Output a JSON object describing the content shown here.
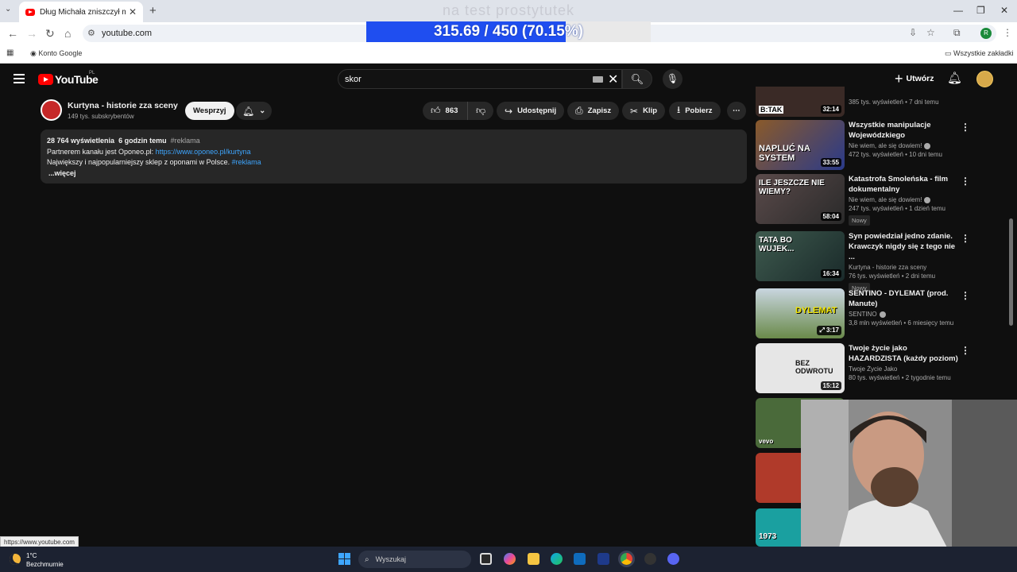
{
  "browser": {
    "tab_title": "Dług Michała zniszczył mu życie",
    "url": "youtube.com",
    "bookmark_left": "Konto Google",
    "bookmark_right": "Wszystkie zakładki",
    "profile_initial": "R",
    "status_link": "https://www.youtube.com"
  },
  "overlay": {
    "title": "na test prostytutek",
    "progress_label": "315.69 / 450 (70.15%)",
    "progress_fraction": 0.7015
  },
  "youtube": {
    "country": "PL",
    "logo_word": "YouTube",
    "search_query": "skor",
    "create_label": "Utwórz"
  },
  "channel": {
    "name": "Kurtyna - historie zza sceny",
    "subs": "149 tys. subskrybentów",
    "support_label": "Wesprzyj",
    "likes": "863",
    "share_label": "Udostępnij",
    "save_label": "Zapisz",
    "clip_label": "Klip",
    "download_label": "Pobierz"
  },
  "description": {
    "views": "28 764 wyświetlenia",
    "time": "6 godzin temu",
    "hashtag": "#reklama",
    "line1_text": "Partnerem kanału jest Oponeo.pl:",
    "line1_link": "https://www.oponeo.pl/kurtyna",
    "line2_text": "Największy i najpopularniejszy sklep z oponami w Polsce.",
    "line2_tag": "#reklama",
    "more": "...więcej"
  },
  "sidebar": {
    "items": [
      {
        "thumb_text": "B:TAK",
        "duration": "32:14",
        "title": "",
        "channel": "",
        "views": "385 tys. wyświetleń",
        "age": "7 dni temu",
        "thumb_color": "#3a2a26"
      },
      {
        "thumb_text": "NAPLUĆ NA SYSTEM",
        "duration": "33:55",
        "title": "Wszystkie manipulacje Wojewódzkiego",
        "channel": "Nie wiem, ale się dowiem!",
        "views": "472 tys. wyświetleń",
        "age": "10 dni temu",
        "thumb_color": "#7a4a2a"
      },
      {
        "thumb_text": "ILE JESZCZE NIE WIEMY?",
        "duration": "58:04",
        "title": "Katastrofa Smoleńska - film dokumentalny",
        "channel": "Nie wiem, ale się dowiem!",
        "views": "247 tys. wyświetleń",
        "age": "1 dzień temu",
        "badge": "Nowy",
        "thumb_color": "#4a3a3a"
      },
      {
        "thumb_text": "TATA BO WUJEK...",
        "duration": "16:34",
        "title": "Syn powiedział jedno zdanie. Krawczyk nigdy się z tego nie ...",
        "channel": "Kurtyna - historie zza sceny",
        "views": "76 tys. wyświetleń",
        "age": "2 dni temu",
        "badge": "Nowy",
        "thumb_color": "#2e4a3e"
      },
      {
        "thumb_text": "DYLEMAT",
        "duration": "3:17",
        "title": "SENTINO - DYLEMAT (prod. Manute)",
        "channel": "SENTINO",
        "views": "3,8 mln wyświetleń",
        "age": "6 miesięcy temu",
        "thumb_color": "#5c7a4a"
      },
      {
        "thumb_text": "BEZ ODWROTU",
        "duration": "15:12",
        "title": "Twoje życie jako HAZARDZISTA (każdy poziom)",
        "channel": "Twoje Życie Jako",
        "views": "80 tys. wyświetleń",
        "age": "2 tygodnie temu",
        "thumb_color": "#d9d9d9"
      }
    ],
    "extra_thumb_texts": [
      "vevo",
      "",
      "1973"
    ]
  },
  "taskbar": {
    "temp": "1°C",
    "weather": "Bezchmurnie",
    "search_placeholder": "Wyszukaj"
  },
  "colors": {
    "yt_bg": "#0f0f0f",
    "accent_link": "#3ea6ff",
    "progress_fill": "#1f4ef0",
    "yt_red": "#ff0000"
  }
}
